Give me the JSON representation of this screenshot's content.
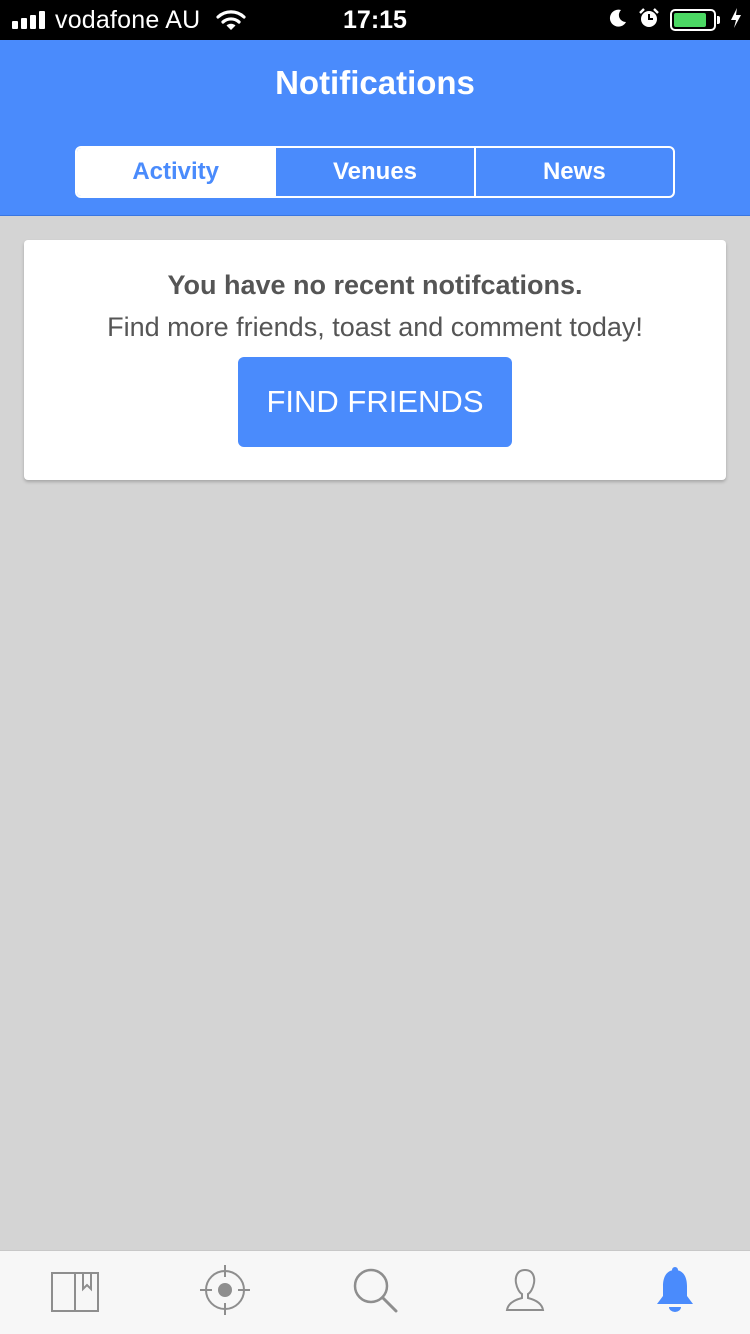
{
  "status_bar": {
    "carrier": "vodafone AU",
    "time": "17:15",
    "signal_bars": 4,
    "battery_level": 0.85,
    "icons": [
      "signal-icon",
      "wifi-icon",
      "moon-icon",
      "alarm-icon",
      "battery-icon",
      "charging-icon"
    ]
  },
  "header": {
    "title": "Notifications",
    "tabs": [
      {
        "label": "Activity",
        "active": true
      },
      {
        "label": "Venues",
        "active": false
      },
      {
        "label": "News",
        "active": false
      }
    ]
  },
  "empty_state": {
    "title": "You have no recent notifcations.",
    "subtitle": "Find more friends, toast and comment today!",
    "button_label": "FIND FRIENDS"
  },
  "tab_bar": {
    "items": [
      {
        "icon": "book-icon",
        "active": false
      },
      {
        "icon": "location-target-icon",
        "active": false
      },
      {
        "icon": "search-icon",
        "active": false
      },
      {
        "icon": "profile-icon",
        "active": false
      },
      {
        "icon": "bell-icon",
        "active": true
      }
    ]
  },
  "colors": {
    "primary": "#4a8bfc",
    "background": "#d4d4d4",
    "card": "#ffffff",
    "text": "#555555",
    "inactive_icon": "#8e8e8e",
    "battery": "#4cd964"
  }
}
